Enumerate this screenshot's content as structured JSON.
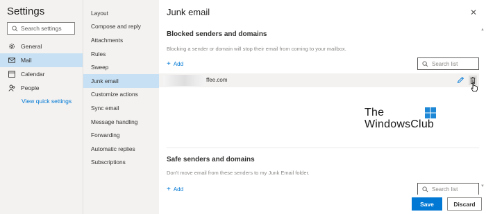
{
  "settings": {
    "title": "Settings",
    "search_placeholder": "Search settings",
    "nav": [
      {
        "label": "General",
        "icon": "gear-icon"
      },
      {
        "label": "Mail",
        "icon": "mail-icon",
        "active": true
      },
      {
        "label": "Calendar",
        "icon": "calendar-icon"
      },
      {
        "label": "People",
        "icon": "people-icon"
      }
    ],
    "view_quick_settings": "View quick settings"
  },
  "mail_menu": {
    "items": [
      "Layout",
      "Compose and reply",
      "Attachments",
      "Rules",
      "Sweep",
      "Junk email",
      "Customize actions",
      "Sync email",
      "Message handling",
      "Forwarding",
      "Automatic replies",
      "Subscriptions"
    ],
    "active": "Junk email"
  },
  "junk": {
    "title": "Junk email",
    "close_icon": "close-icon",
    "blocked": {
      "title": "Blocked senders and domains",
      "description": "Blocking a sender or domain will stop their email from coming to your mailbox.",
      "add_label": "Add",
      "search_placeholder": "Search list",
      "entries": [
        "ffee.com"
      ]
    },
    "safe": {
      "title": "Safe senders and domains",
      "description": "Don't move email from these senders to my Junk Email folder.",
      "add_label": "Add",
      "search_placeholder": "Search list"
    }
  },
  "watermark": {
    "line1": "The",
    "line2": "WindowsClub"
  },
  "footer": {
    "save_label": "Save",
    "discard_label": "Discard"
  },
  "colors": {
    "accent": "#0078d4",
    "selected": "#c7e0f4",
    "pane": "#f3f2f1"
  }
}
